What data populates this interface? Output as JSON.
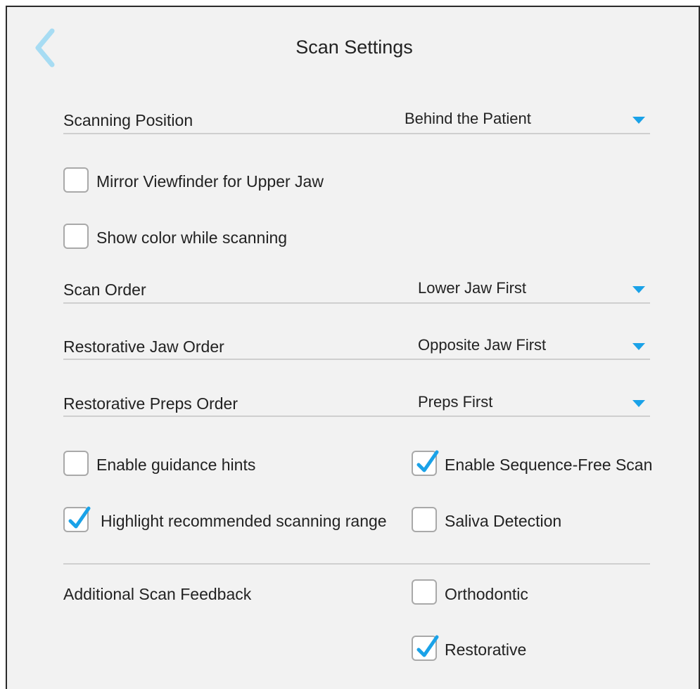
{
  "header": {
    "title": "Scan Settings",
    "back_icon": "chevron-left-icon"
  },
  "colors": {
    "accent": "#1aa2e8",
    "back_icon": "#a7dcf3",
    "background": "#f2f2f2",
    "checkbox_border": "#a9a9a9"
  },
  "scanning_position": {
    "label": "Scanning Position",
    "value": "Behind the Patient"
  },
  "mirror_viewfinder": {
    "label": "Mirror Viewfinder for Upper Jaw",
    "checked": false
  },
  "show_color": {
    "label": "Show color while scanning",
    "checked": false
  },
  "scan_order": {
    "label": "Scan Order",
    "value": "Lower Jaw First"
  },
  "restorative_jaw_order": {
    "label": "Restorative Jaw Order",
    "value": "Opposite Jaw First"
  },
  "restorative_preps_order": {
    "label": "Restorative Preps Order",
    "value": "Preps First"
  },
  "guidance_hints": {
    "label": "Enable guidance hints",
    "checked": false
  },
  "sequence_free": {
    "label": "Enable Sequence-Free Scan",
    "checked": true
  },
  "highlight_range": {
    "label": "Highlight recommended scanning range",
    "checked": true
  },
  "saliva_detection": {
    "label": "Saliva Detection",
    "checked": false
  },
  "additional_feedback": {
    "label": "Additional Scan Feedback",
    "orthodontic": {
      "label": "Orthodontic",
      "checked": false
    },
    "restorative": {
      "label": "Restorative",
      "checked": true
    }
  }
}
